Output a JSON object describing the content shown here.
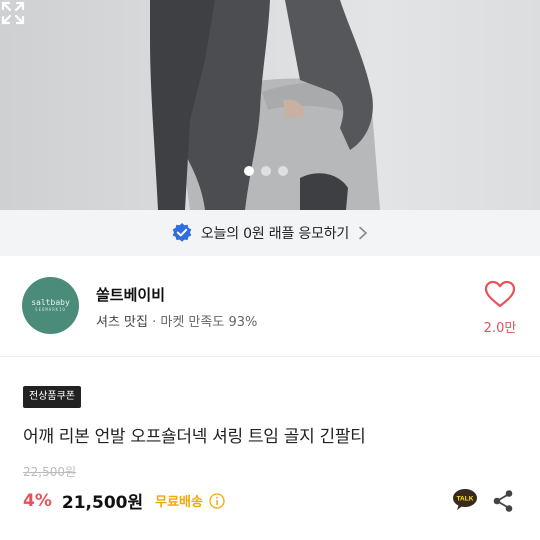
{
  "gallery": {
    "slide_count": 3,
    "active_slide": 1,
    "expand_icon": "expand-icon"
  },
  "raffle": {
    "label": "오늘의 0원 래플 응모하기",
    "badge_icon": "verified-badge-icon",
    "badge_color": "#2f6ee0"
  },
  "shop": {
    "avatar_line1": "saltbaby",
    "avatar_line2": "SEOMARKIO",
    "avatar_color": "#4a8b7a",
    "name": "쏠트베이비",
    "tagline": "셔츠 맛집",
    "satisfaction": " · 마켓 만족도 93%",
    "like_count": "2.0만",
    "like_icon": "heart-outline-icon",
    "like_color": "#e8525b"
  },
  "product": {
    "coupon_label": "전상품쿠폰",
    "title": "어깨 리본 언발 오프숄더넥 셔링 트임 골지 긴팔티",
    "original_price": "22,500원",
    "discount": "4%",
    "price": "21,500원",
    "shipping": "무료배송",
    "shipping_color": "#f0a70a",
    "talk_icon": "kakao-talk-icon",
    "share_icon": "share-icon"
  }
}
